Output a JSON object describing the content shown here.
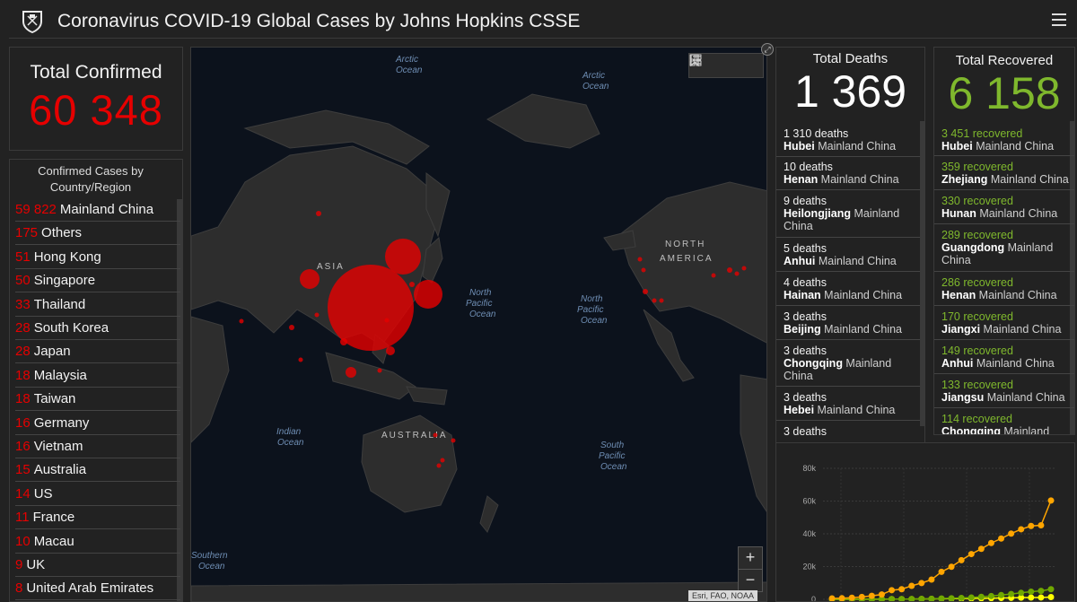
{
  "header": {
    "title": "Coronavirus COVID-19 Global Cases by Johns Hopkins CSSE"
  },
  "total_confirmed": {
    "label": "Total Confirmed",
    "value": "60 348"
  },
  "country_list": {
    "heading_line1": "Confirmed Cases by",
    "heading_line2": "Country/Region",
    "rows": [
      {
        "count": "59 822",
        "name": "Mainland China"
      },
      {
        "count": "175",
        "name": "Others"
      },
      {
        "count": "51",
        "name": "Hong Kong"
      },
      {
        "count": "50",
        "name": "Singapore"
      },
      {
        "count": "33",
        "name": "Thailand"
      },
      {
        "count": "28",
        "name": "South Korea"
      },
      {
        "count": "28",
        "name": "Japan"
      },
      {
        "count": "18",
        "name": "Malaysia"
      },
      {
        "count": "18",
        "name": "Taiwan"
      },
      {
        "count": "16",
        "name": "Germany"
      },
      {
        "count": "16",
        "name": "Vietnam"
      },
      {
        "count": "15",
        "name": "Australia"
      },
      {
        "count": "14",
        "name": "US"
      },
      {
        "count": "11",
        "name": "France"
      },
      {
        "count": "10",
        "name": "Macau"
      },
      {
        "count": "9",
        "name": "UK"
      },
      {
        "count": "8",
        "name": "United Arab Emirates"
      }
    ]
  },
  "map": {
    "labels": {
      "arctic_ocean_1": "Arctic",
      "arctic_ocean_1b": "Ocean",
      "arctic_ocean_2": "Arctic",
      "arctic_ocean_2b": "Ocean",
      "north_pacific_1a": "North",
      "north_pacific_1b": "Pacific",
      "north_pacific_1c": "Ocean",
      "north_pacific_2a": "North",
      "north_pacific_2b": "Pacific",
      "north_pacific_2c": "Ocean",
      "indian_ocean_a": "Indian",
      "indian_ocean_b": "Ocean",
      "south_pacific_a": "South",
      "south_pacific_b": "Pacific",
      "south_pacific_c": "Ocean",
      "southern_ocean_a": "Southern",
      "southern_ocean_b": "Ocean",
      "asia": "ASIA",
      "australia": "AUSTRALIA",
      "north_america_a": "NORTH",
      "north_america_b": "AMERICA"
    },
    "zoom_in": "+",
    "zoom_out": "−",
    "attribution": "Esri, FAO, NOAA",
    "bubble_color": "#e60000"
  },
  "total_deaths": {
    "label": "Total Deaths",
    "value": "1 369",
    "rows": [
      {
        "num": "1 310 deaths",
        "bold": "Hubei",
        "rest": " Mainland China"
      },
      {
        "num": "10 deaths",
        "bold": "Henan",
        "rest": " Mainland China"
      },
      {
        "num": "9 deaths",
        "bold": "Heilongjiang",
        "rest": " Mainland China"
      },
      {
        "num": "5 deaths",
        "bold": "Anhui",
        "rest": " Mainland China"
      },
      {
        "num": "4 deaths",
        "bold": "Hainan",
        "rest": " Mainland China"
      },
      {
        "num": "3 deaths",
        "bold": "Beijing",
        "rest": " Mainland China"
      },
      {
        "num": "3 deaths",
        "bold": "Chongqing",
        "rest": " Mainland China"
      },
      {
        "num": "3 deaths",
        "bold": "Hebei",
        "rest": " Mainland China"
      },
      {
        "num": "3 deaths",
        "bold": "",
        "rest": ""
      }
    ]
  },
  "total_recovered": {
    "label": "Total Recovered",
    "value": "6 158",
    "rows": [
      {
        "num": "3 451 recovered",
        "bold": "Hubei",
        "rest": " Mainland China"
      },
      {
        "num": "359 recovered",
        "bold": "Zhejiang",
        "rest": " Mainland China"
      },
      {
        "num": "330 recovered",
        "bold": "Hunan",
        "rest": " Mainland China"
      },
      {
        "num": "289 recovered",
        "bold": "Guangdong",
        "rest": " Mainland China"
      },
      {
        "num": "286 recovered",
        "bold": "Henan",
        "rest": " Mainland China"
      },
      {
        "num": "170 recovered",
        "bold": "Jiangxi",
        "rest": " Mainland China"
      },
      {
        "num": "149 recovered",
        "bold": "Anhui",
        "rest": " Mainland China"
      },
      {
        "num": "133 recovered",
        "bold": "Jiangsu",
        "rest": " Mainland China"
      },
      {
        "num": "114 recovered",
        "bold": "Chongqing",
        "rest": " Mainland"
      }
    ]
  },
  "colors": {
    "confirmed": "#e60000",
    "recovered": "#7fb82d",
    "chart_total": "#ffa500",
    "chart_recovered": "#70a800",
    "chart_deaths": "#ffff00"
  },
  "chart_data": {
    "type": "line",
    "y_ticks": [
      "80k",
      "60k",
      "40k",
      "20k",
      "0"
    ],
    "ylim": [
      0,
      80000
    ],
    "series": [
      {
        "key": "confirmed",
        "values": [
          555,
          653,
          941,
          1438,
          2118,
          2927,
          5578,
          6165,
          8235,
          9925,
          12038,
          16787,
          19881,
          23892,
          27635,
          30817,
          34391,
          37120,
          40150,
          42762,
          44802,
          45221,
          60348
        ]
      },
      {
        "key": "recovered",
        "values": [
          28,
          30,
          36,
          39,
          52,
          61,
          107,
          126,
          143,
          222,
          284,
          472,
          623,
          852,
          1124,
          1487,
          2011,
          2616,
          3244,
          3946,
          4683,
          5150,
          6158
        ]
      },
      {
        "key": "deaths",
        "values": [
          17,
          18,
          26,
          42,
          56,
          82,
          131,
          133,
          171,
          213,
          259,
          362,
          426,
          492,
          564,
          634,
          719,
          806,
          906,
          1013,
          1113,
          1118,
          1369
        ]
      }
    ]
  }
}
